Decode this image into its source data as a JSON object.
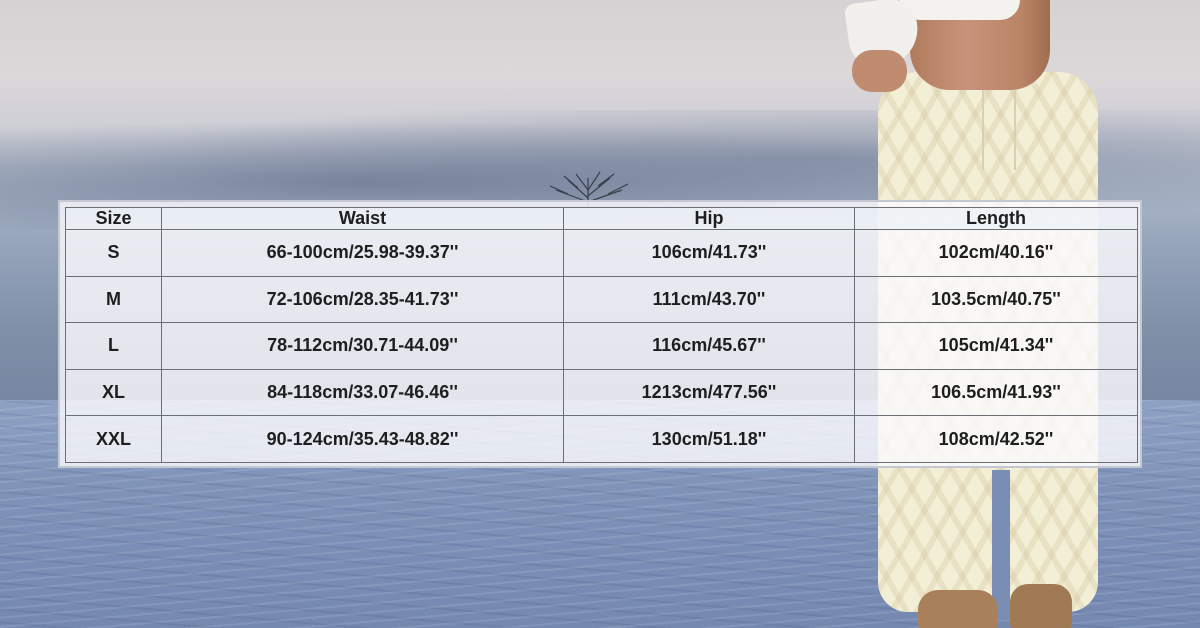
{
  "size_chart": {
    "headers": [
      "Size",
      "Waist",
      "Hip",
      "Length"
    ],
    "rows": [
      {
        "size": "S",
        "waist": "66-100cm/25.98-39.37''",
        "hip": "106cm/41.73''",
        "length": "102cm/40.16''"
      },
      {
        "size": "M",
        "waist": "72-106cm/28.35-41.73''",
        "hip": "111cm/43.70''",
        "length": "103.5cm/40.75''"
      },
      {
        "size": "L",
        "waist": "78-112cm/30.71-44.09''",
        "hip": "116cm/45.67''",
        "length": "105cm/41.34''"
      },
      {
        "size": "XL",
        "waist": "84-118cm/33.07-46.46''",
        "hip": "1213cm/477.56''",
        "length": "106.5cm/41.93''"
      },
      {
        "size": "XXL",
        "waist": "90-124cm/35.43-48.82''",
        "hip": "130cm/51.18''",
        "length": "108cm/42.52''"
      }
    ]
  },
  "colors": {
    "sky_top": "#d6d2d3",
    "ground": "#7f92b8",
    "pants": "#f3eed6",
    "boots": "#a8805a",
    "table_border": "#6d6f75",
    "text": "#1e1e1e"
  }
}
